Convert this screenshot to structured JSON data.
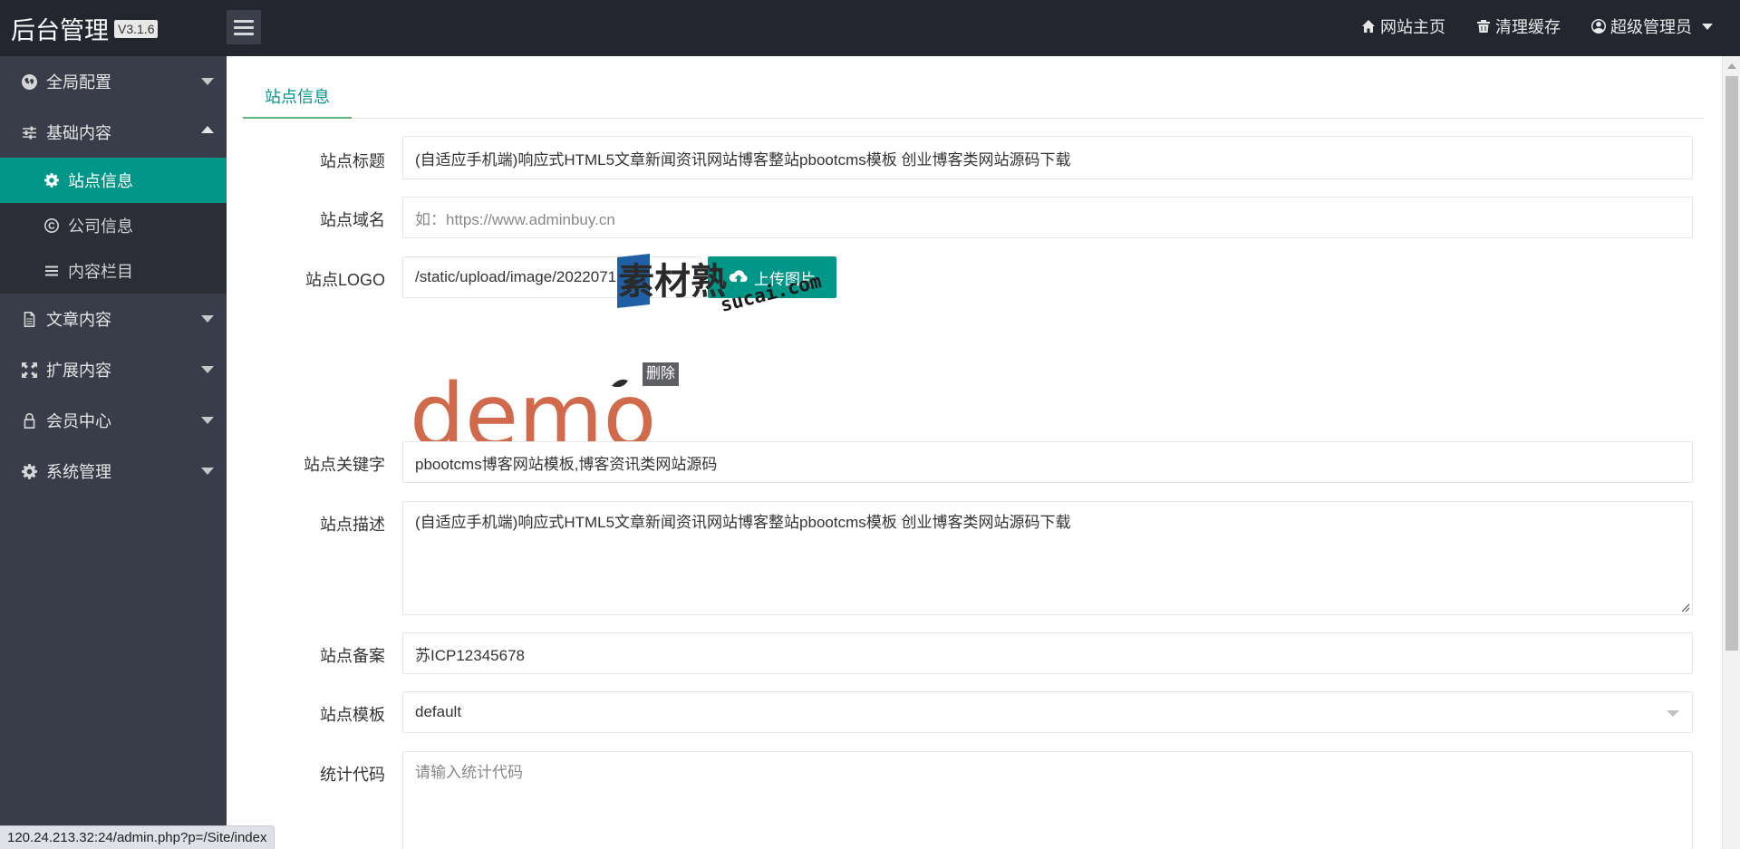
{
  "header": {
    "title": "后台管理",
    "version": "V3.1.6",
    "links": [
      {
        "icon": "home-icon",
        "label": "网站主页"
      },
      {
        "icon": "trash-icon",
        "label": "清理缓存"
      },
      {
        "icon": "user-circle-icon",
        "label": "超级管理员"
      }
    ]
  },
  "sidebar": {
    "items": [
      {
        "label": "全局配置",
        "icon": "globe-icon",
        "expanded": false
      },
      {
        "label": "基础内容",
        "icon": "sliders-icon",
        "expanded": true,
        "children": [
          {
            "label": "站点信息",
            "icon": "gear-icon",
            "active": true
          },
          {
            "label": "公司信息",
            "icon": "copyright-icon",
            "active": false
          },
          {
            "label": "内容栏目",
            "icon": "list-icon",
            "active": false
          }
        ]
      },
      {
        "label": "文章内容",
        "icon": "file-icon",
        "expanded": false
      },
      {
        "label": "扩展内容",
        "icon": "expand-icon",
        "expanded": false
      },
      {
        "label": "会员中心",
        "icon": "lock-icon",
        "expanded": false
      },
      {
        "label": "系统管理",
        "icon": "gear-icon",
        "expanded": false
      }
    ]
  },
  "tabs": [
    {
      "label": "站点信息",
      "active": true
    }
  ],
  "form": {
    "title": {
      "label": "站点标题",
      "value": "(自适应手机端)响应式HTML5文章新闻资讯网站博客整站pbootcms模板 创业博客类网站源码下载"
    },
    "domain": {
      "label": "站点域名",
      "value": "",
      "placeholder": "如：https://www.adminbuy.cn"
    },
    "logo": {
      "label": "站点LOGO",
      "value": "/static/upload/image/2022071",
      "upload_label": "上传图片",
      "delete_label": "删除",
      "preview_text": "demo"
    },
    "keywords": {
      "label": "站点关键字",
      "value": "pbootcms博客网站模板,博客资讯类网站源码"
    },
    "description": {
      "label": "站点描述",
      "value": "(自适应手机端)响应式HTML5文章新闻资讯网站博客整站pbootcms模板 创业博客类网站源码下载"
    },
    "icp": {
      "label": "站点备案",
      "value": "苏ICP12345678"
    },
    "template": {
      "label": "站点模板",
      "value": "default"
    },
    "stats_code": {
      "label": "统计代码",
      "value": "",
      "placeholder": "请输入统计代码"
    }
  },
  "watermark": {
    "text_cn": "素材熟",
    "text_en": "sucai.com"
  },
  "status_url": "120.24.213.32:24/admin.php?p=/Site/index",
  "colors": {
    "header_bg": "#23262e",
    "sidebar_bg": "#393d49",
    "submenu_bg": "#2b2e37",
    "accent": "#009688",
    "logo_color": "#d06a4a"
  }
}
